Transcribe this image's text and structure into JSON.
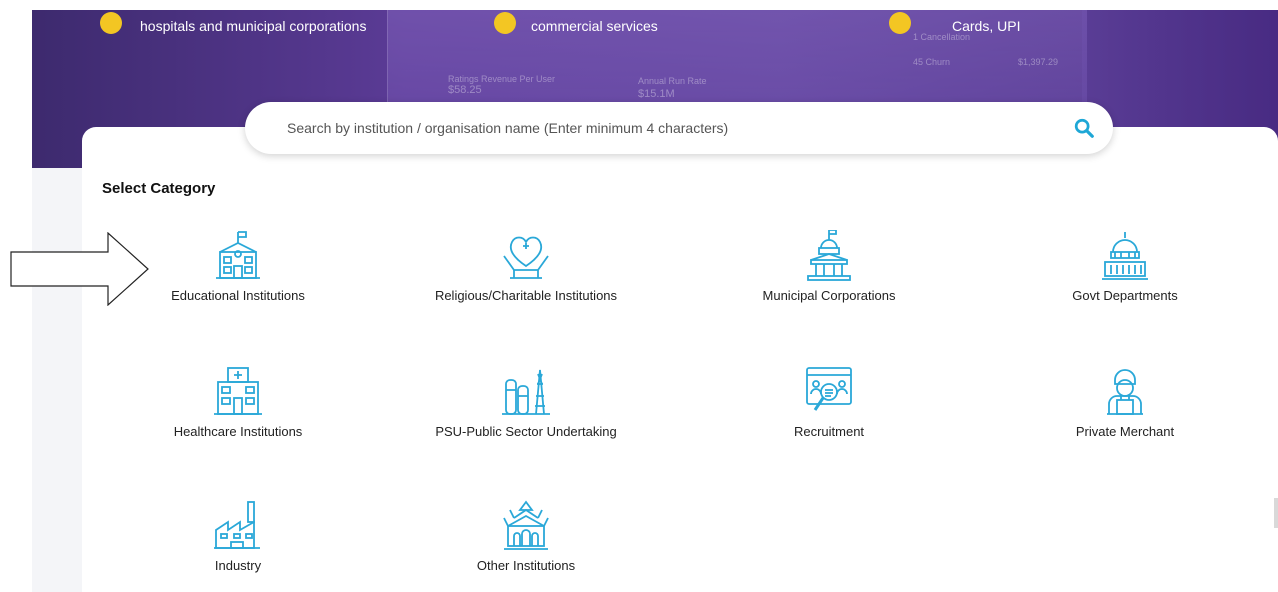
{
  "hero": {
    "features": [
      {
        "text": "hospitals and municipal corporations"
      },
      {
        "text": "commercial services"
      },
      {
        "text": "Cards, UPI"
      }
    ]
  },
  "search": {
    "placeholder": "Search by institution / organisation name (Enter minimum 4 characters)",
    "icon": "search-icon"
  },
  "section": {
    "title": "Select Category"
  },
  "categories": [
    {
      "label": "Educational Institutions",
      "icon": "school-icon"
    },
    {
      "label": "Religious/Charitable Institutions",
      "icon": "heart-hands-icon"
    },
    {
      "label": "Municipal Corporations",
      "icon": "municipal-building-icon"
    },
    {
      "label": "Govt Departments",
      "icon": "capitol-icon"
    },
    {
      "label": "Healthcare Institutions",
      "icon": "hospital-icon"
    },
    {
      "label": "PSU-Public Sector Undertaking",
      "icon": "refinery-icon"
    },
    {
      "label": "Recruitment",
      "icon": "recruitment-icon"
    },
    {
      "label": "Private Merchant",
      "icon": "merchant-icon"
    },
    {
      "label": "Industry",
      "icon": "factory-icon"
    },
    {
      "label": "Other Institutions",
      "icon": "temple-icon"
    }
  ],
  "colors": {
    "accent": "#1ea7d6",
    "icon": "#2aa8d8",
    "hero": "#5b3b96",
    "highlight": "#f3c623"
  }
}
